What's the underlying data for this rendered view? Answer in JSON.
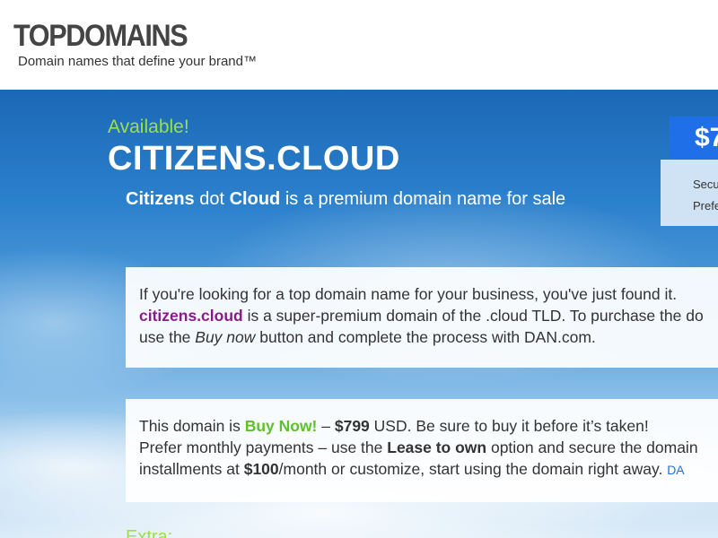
{
  "header": {
    "logo": "TOPDOMAINS",
    "tagline": "Domain names that define your brand™"
  },
  "hero": {
    "available_label": "Available!",
    "domain_name": "CITIZENS.CLOUD",
    "subtitle": {
      "part1": "Citizens",
      "part2": " dot ",
      "part3": "Cloud",
      "part4": " is a premium domain name for sale"
    }
  },
  "price_panel": {
    "price_partial": "$7",
    "line1": "Secu",
    "line2": "Prefe"
  },
  "description_card": {
    "line1": "If you're looking for a top domain name for your business, you've just found it.",
    "domain_link": "citizens.cloud",
    "line2_rest": " is a super-premium domain of the .cloud TLD. To purchase the do",
    "line3_a": "use the ",
    "line3_buy_now": "Buy now",
    "line3_b": " button and complete the process with DAN.com."
  },
  "pricing_card": {
    "line1_a": "This domain is ",
    "line1_buy_now": "Buy Now!",
    "line1_b": " – ",
    "line1_price": "$799",
    "line1_c": " USD. Be sure to buy it before it’s taken!",
    "line2_a": "Prefer monthly payments – use the ",
    "line2_lease": "Lease to own",
    "line2_b": " option and secure the domain",
    "line3_a": "installments at ",
    "line3_monthly": "$100",
    "line3_b": "/month or customize, start using the domain right away.",
    "line3_link": "DA"
  },
  "extra_heading": "Extra:",
  "colors": {
    "accent_green": "#9be04a",
    "accent_blue": "#1f6fe8",
    "domain_purple": "#8a1a8a"
  }
}
